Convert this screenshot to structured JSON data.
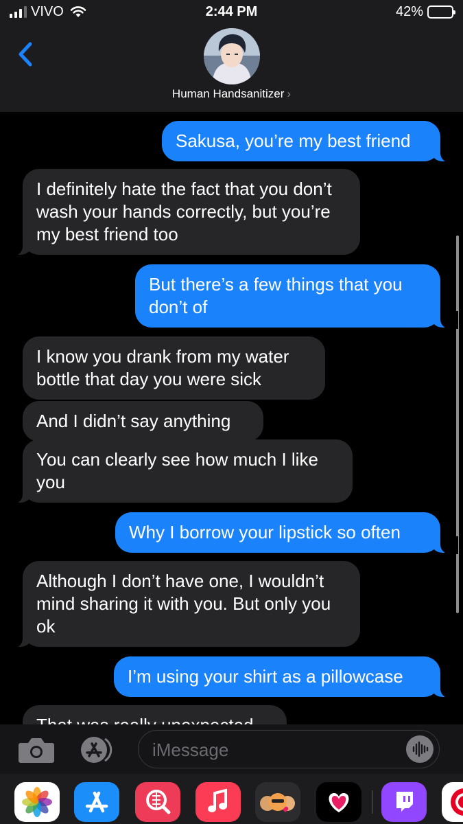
{
  "status_bar": {
    "carrier": "VIVO",
    "time": "2:44 PM",
    "battery_percent": "42%",
    "battery_level": 0.42,
    "battery_color": "#f7cf1d"
  },
  "header": {
    "back_icon": "chevron-left-icon",
    "contact_name": "Human Handsanitizer",
    "contact_chevron": "›"
  },
  "messages": [
    {
      "from": "me",
      "text": "Sakusa, you’re my best friend"
    },
    {
      "from": "them",
      "text": "I definitely hate the fact that you don’t wash your hands correctly, but you’re my best friend too"
    },
    {
      "from": "me",
      "text": "But there’s a few things that you don’t of"
    },
    {
      "from": "them",
      "text": "I know you drank from my water bottle that day you were sick"
    },
    {
      "from": "them",
      "text": "And I didn’t say anything"
    },
    {
      "from": "them",
      "text": "You can clearly see how much I like you"
    },
    {
      "from": "me",
      "text": "Why I borrow your lipstick so often"
    },
    {
      "from": "them",
      "text": "Although I don’t have one, I wouldn’t mind sharing it with you. But only you ok"
    },
    {
      "from": "me",
      "text": "I’m using your shirt as a pillowcase"
    },
    {
      "from": "them",
      "text": "That was really unexpected"
    }
  ],
  "compose": {
    "camera_icon": "camera-icon",
    "apps_icon": "app-store-icon",
    "placeholder": "iMessage",
    "audio_icon": "waveform-icon"
  },
  "app_drawer": [
    {
      "name": "photos-icon",
      "color": "#ffffff"
    },
    {
      "name": "app-store-icon",
      "color": "#1c8ef9"
    },
    {
      "name": "images-search-icon",
      "color": "#ee3b57"
    },
    {
      "name": "music-icon",
      "color": "#fb3c54"
    },
    {
      "name": "memoji-icon",
      "color": "#2c2c2e"
    },
    {
      "name": "heart-app-icon",
      "color": "#000000"
    },
    {
      "name": "twitch-icon",
      "color": "#9146ff"
    },
    {
      "name": "pinterest-icon",
      "color": "#ffffff"
    }
  ],
  "colors": {
    "sent_bubble": "#1a82fb",
    "received_bubble": "#262629",
    "accent": "#1a82fb"
  }
}
